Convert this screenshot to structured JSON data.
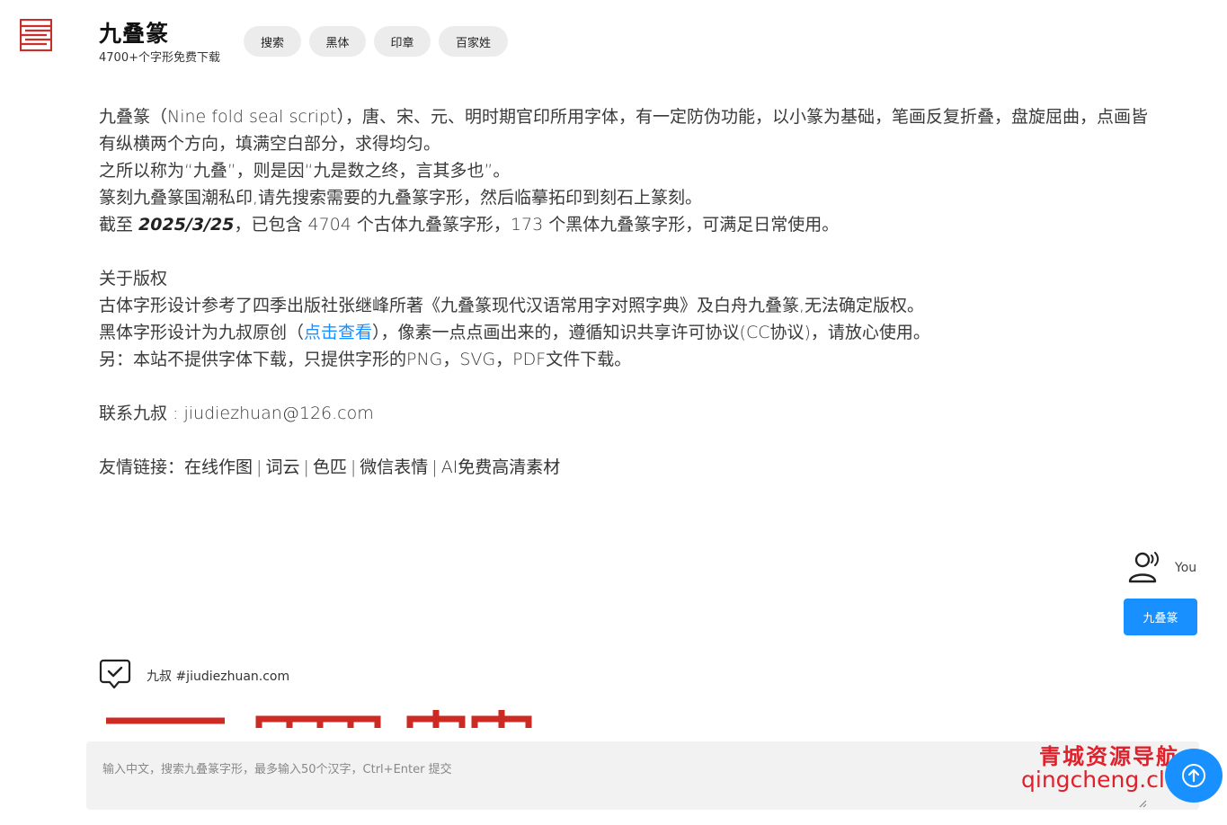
{
  "header": {
    "title": "九叠篆",
    "subtitle": "4700+个字形免费下载",
    "logo_icon": "seal-logo-icon",
    "nav": [
      {
        "label": "搜索"
      },
      {
        "label": "黑体"
      },
      {
        "label": "印章"
      },
      {
        "label": "百家姓"
      }
    ]
  },
  "intro": {
    "p1_part1": "九叠篆（Nine fold seal script），唐、宋、元、明时期官印所用字体，有一定防伪功能，以小篆为基础，笔画反复折叠，盘旋屈曲，点画皆",
    "p1_part2": "有纵横两个方向，填满空白部分，求得均匀。",
    "p2": "之所以称为“九叠”，则是因“九是数之终，言其多也”。",
    "p3": "篆刻九叠篆国潮私印,请先搜索需要的九叠篆字形，然后临摹拓印到刻石上篆刻。",
    "p4_prefix": "截至 ",
    "p4_date": "2025/3/25",
    "p4_suffix": "，已包含 4704 个古体九叠篆字形，173 个黑体九叠篆字形，可满足日常使用。",
    "copyright_title": "关于版权",
    "copyright_1": "古体字形设计参考了四季出版社张继峰所著《九叠篆现代汉语常用字对照字典》及白舟九叠篆,无法确定版权。",
    "copyright_2_prefix": "黑体字形设计为九叔原创（",
    "copyright_2_link": "点击查看",
    "copyright_2_suffix": "），像素一点点画出来的，遵循知识共享许可协议(CC协议)，请放心使用。",
    "copyright_3": "另：本站不提供字体下载，只提供字形的PNG，SVG，PDF文件下载。",
    "contact": "联系九叔 : jiudiezhuan@126.com",
    "links_label": "友情链接：",
    "links": [
      "在线作图",
      "词云",
      "色匹",
      "微信表情",
      "AI免费高清素材"
    ],
    "link_separator": "|"
  },
  "chat": {
    "user_label": "You",
    "user_icon": "user-speaking-icon",
    "user_message": "九叠篆",
    "bot_label": "九叔 #jiudiezhuan.com",
    "bot_icon": "chat-check-icon",
    "result_color": "#cc2a22"
  },
  "input": {
    "placeholder": "输入中文，搜索九叠篆字形，最多输入50个汉字，Ctrl+Enter 提交",
    "send_icon": "arrow-up-icon"
  },
  "watermark": {
    "line1": "青城资源导航",
    "line2": "qingcheng.club",
    "color": "#e0202b"
  },
  "colors": {
    "accent": "#1890ff",
    "logo": "#c9302c"
  }
}
